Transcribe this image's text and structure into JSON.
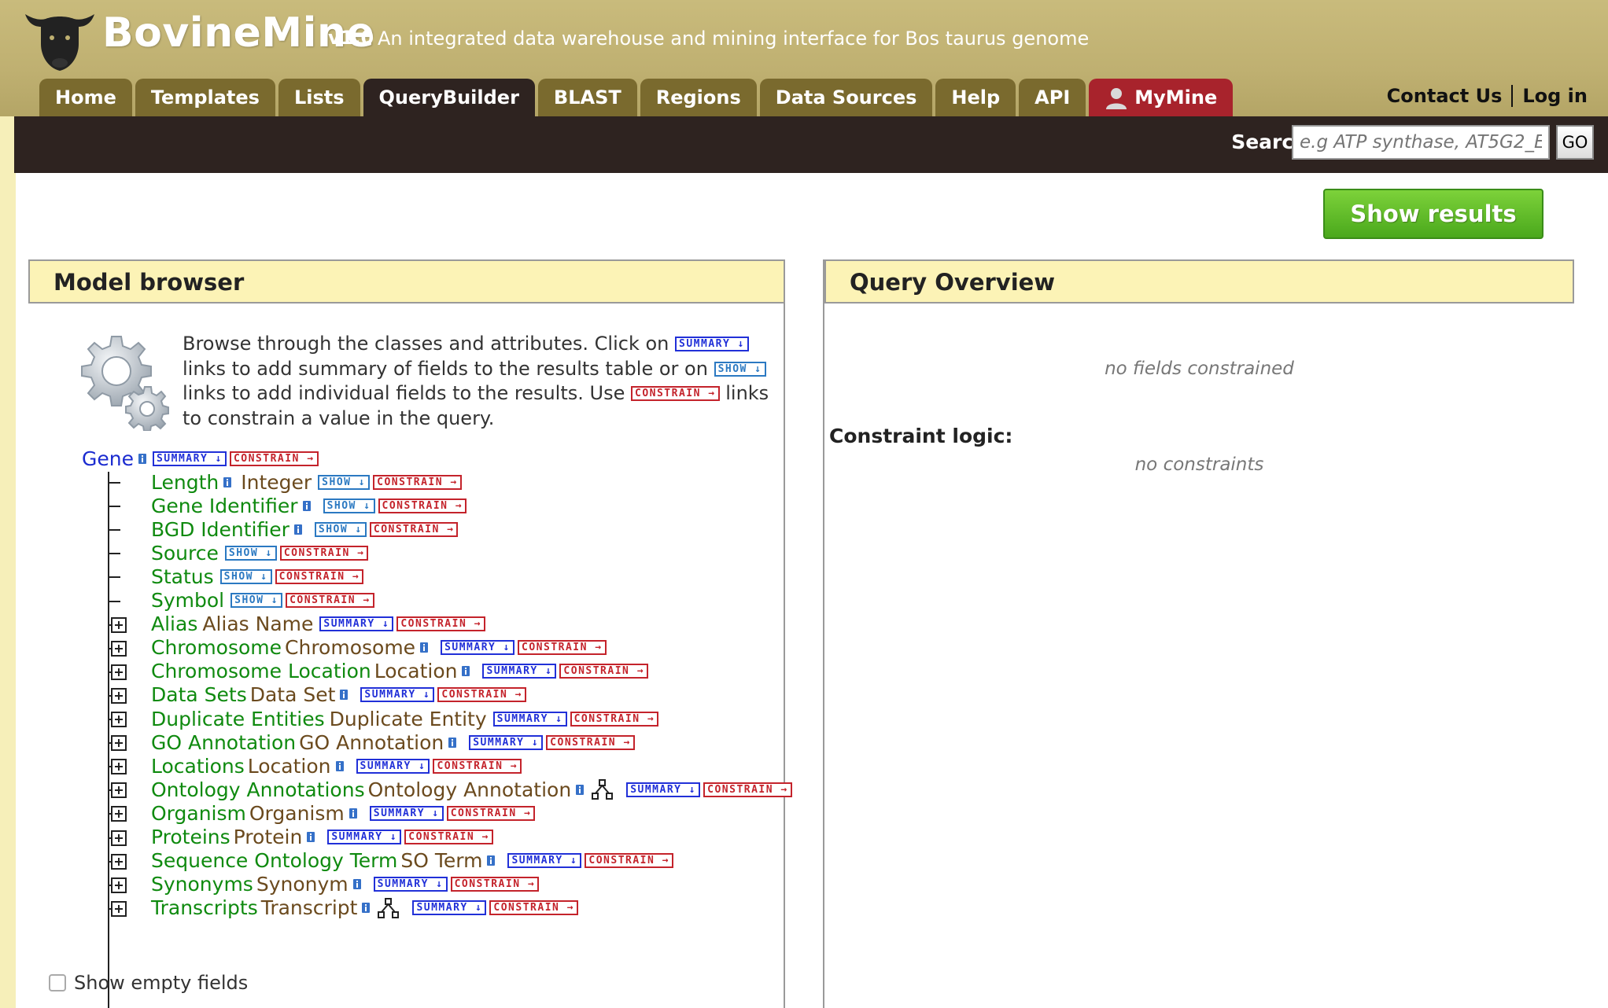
{
  "header": {
    "app_name": "BovineMine",
    "version": "v1.0",
    "tagline": "An integrated data warehouse and mining interface for Bos taurus genome",
    "tabs": [
      {
        "label": "Home"
      },
      {
        "label": "Templates"
      },
      {
        "label": "Lists"
      },
      {
        "label": "QueryBuilder"
      },
      {
        "label": "BLAST"
      },
      {
        "label": "Regions"
      },
      {
        "label": "Data Sources"
      },
      {
        "label": "Help"
      },
      {
        "label": "API"
      },
      {
        "label": "MyMine"
      }
    ],
    "active_tab": "QueryBuilder",
    "contact_link": "Contact Us",
    "login_link": "Log in"
  },
  "search": {
    "label": "Search:",
    "placeholder": "e.g ATP synthase, AT5G2_E",
    "go_label": "GO"
  },
  "actions": {
    "show_results": "Show results"
  },
  "model_browser": {
    "title": "Model browser",
    "intro_parts": [
      "Browse through the classes and attributes. Click on",
      "links to add summary of fields to the results table or on",
      "links to add individual fields to the results. Use",
      "links to constrain a value in the query."
    ],
    "tag_labels": {
      "summary": "SUMMARY ↓",
      "show": "SHOW ↓",
      "constrain": "CONSTRAIN →"
    },
    "root": {
      "label": "Gene"
    },
    "attributes": [
      {
        "name": "Length",
        "type": "Integer",
        "info": true
      },
      {
        "name": "Gene Identifier",
        "type": "",
        "info": true
      },
      {
        "name": "BGD Identifier",
        "type": "",
        "info": true
      },
      {
        "name": "Source",
        "type": "",
        "info": false
      },
      {
        "name": "Status",
        "type": "",
        "info": false
      },
      {
        "name": "Symbol",
        "type": "",
        "info": false
      }
    ],
    "references": [
      {
        "name": "Alias",
        "type": "Alias Name",
        "info": false,
        "subclass": false
      },
      {
        "name": "Chromosome",
        "type": "Chromosome",
        "info": true,
        "subclass": false
      },
      {
        "name": "Chromosome Location",
        "type": "Location",
        "info": true,
        "subclass": false
      },
      {
        "name": "Data Sets",
        "type": "Data Set",
        "info": true,
        "subclass": false
      },
      {
        "name": "Duplicate Entities",
        "type": "Duplicate Entity",
        "info": false,
        "subclass": false
      },
      {
        "name": "GO Annotation",
        "type": "GO Annotation",
        "info": true,
        "subclass": false
      },
      {
        "name": "Locations",
        "type": "Location",
        "info": true,
        "subclass": false
      },
      {
        "name": "Ontology Annotations",
        "type": "Ontology Annotation",
        "info": true,
        "subclass": true
      },
      {
        "name": "Organism",
        "type": "Organism",
        "info": true,
        "subclass": false
      },
      {
        "name": "Proteins",
        "type": "Protein",
        "info": true,
        "subclass": false
      },
      {
        "name": "Sequence Ontology Term",
        "type": "SO Term",
        "info": true,
        "subclass": false
      },
      {
        "name": "Synonyms",
        "type": "Synonym",
        "info": true,
        "subclass": false
      },
      {
        "name": "Transcripts",
        "type": "Transcript",
        "info": true,
        "subclass": true
      }
    ],
    "show_empty_label": "Show empty fields",
    "show_empty_checked": false
  },
  "query_overview": {
    "title": "Query Overview",
    "no_fields": "no fields constrained",
    "logic_label": "Constraint logic:",
    "no_constraints": "no constraints"
  },
  "colors": {
    "header_bg": "#bfb071",
    "tab_bg": "#7a6a2e",
    "tab_active": "#2e2320",
    "mymine_tab": "#a8232c",
    "field_green": "#0f8a0f",
    "type_brown": "#6b4a1e",
    "root_blue": "#1b2bd0",
    "show_results_green": "#4aa81c"
  }
}
